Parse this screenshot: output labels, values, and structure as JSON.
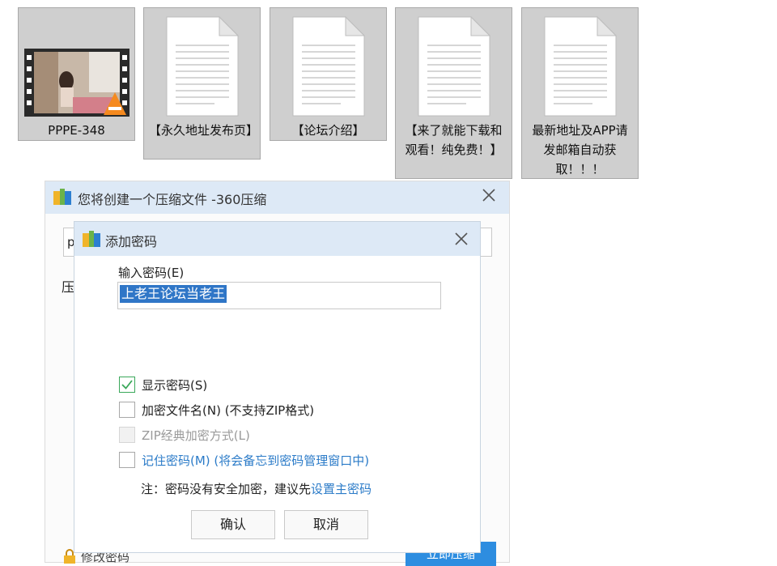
{
  "files": [
    {
      "label": "PPPE-348",
      "type": "video"
    },
    {
      "label": "【永久地址发布页】",
      "type": "document"
    },
    {
      "label": "【论坛介绍】",
      "type": "document"
    },
    {
      "label": "【来了就能下载和观看！纯免费！】",
      "type": "document"
    },
    {
      "label": "最新地址及APP请发邮箱自动获取！！！",
      "type": "document"
    }
  ],
  "compress_window": {
    "title": "您将创建一个压缩文件 -360压缩",
    "path_value": "p",
    "compress_label": "压",
    "modify_password": "修改密码",
    "compress_button": "立即压缩",
    "accent_color": "#2d8de0"
  },
  "password_dialog": {
    "title": "添加密码",
    "input_label": "输入密码(E)",
    "password_value": "上老王论坛当老王",
    "options": [
      {
        "label": "显示密码(S)",
        "checked": true,
        "enabled": true
      },
      {
        "label": "加密文件名(N) (不支持ZIP格式)",
        "checked": false,
        "enabled": true
      },
      {
        "label": "ZIP经典加密方式(L)",
        "checked": false,
        "enabled": false
      },
      {
        "label": "记住密码(M) (将会备忘到密码管理窗口中)",
        "checked": false,
        "enabled": true
      }
    ],
    "note_prefix": "注：密码没有安全加密，建议先",
    "note_link": "设置主密码",
    "ok_button": "确认",
    "cancel_button": "取消"
  },
  "icons": {
    "app": "360zip-app-icon",
    "close": "close-icon",
    "check": "checkmark-icon",
    "document": "document-icon",
    "video": "video-thumbnail-icon"
  }
}
